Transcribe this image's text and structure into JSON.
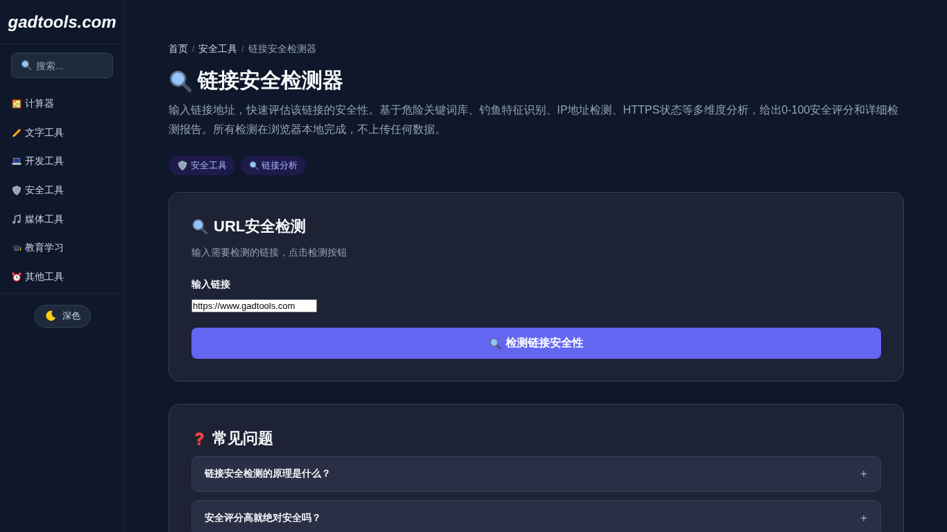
{
  "sidebar": {
    "logo": "gadtools.com",
    "search": {
      "placeholder": "搜索..."
    },
    "items": [
      {
        "label": "计算器"
      },
      {
        "label": "文字工具"
      },
      {
        "label": "开发工具"
      },
      {
        "label": "安全工具"
      },
      {
        "label": "媒体工具"
      },
      {
        "label": "教育学习"
      },
      {
        "label": "其他工具"
      }
    ],
    "theme_button": "深色"
  },
  "breadcrumb_separator": "/",
  "breadcrumb": [
    {
      "label": "首页",
      "current": false
    },
    {
      "label": "安全工具",
      "current": false
    },
    {
      "label": "链接安全检测器",
      "current": true
    }
  ],
  "page": {
    "title": "链接安全检测器",
    "description": "输入链接地址，快速评估该链接的安全性。基于危险关键词库、钓鱼特征识别、IP地址检测、HTTPS状态等多维度分析，给出0-100安全评分和详细检测报告。所有检测在浏览器本地完成，不上传任何数据。",
    "tags": [
      {
        "label": "安全工具"
      },
      {
        "label": "链接分析"
      }
    ]
  },
  "checker": {
    "title": "URL安全检测",
    "subtitle": "输入需要检测的链接，点击检测按钮",
    "field_label": "输入链接",
    "value": "https://www.gadtools.com",
    "button": "检测链接安全性"
  },
  "faq": {
    "title": "常见问题",
    "items": [
      {
        "question": "链接安全检测的原理是什么？",
        "expanded": false
      },
      {
        "question": "安全评分高就绝对安全吗？",
        "expanded": false
      }
    ]
  }
}
